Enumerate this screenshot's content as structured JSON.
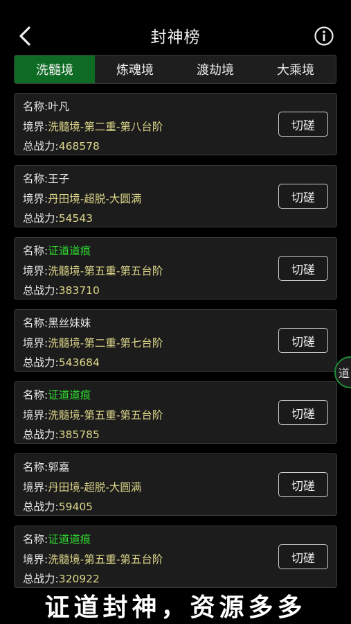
{
  "header": {
    "title": "封神榜",
    "back_icon": "chevron-left-icon",
    "info_icon": "info-icon"
  },
  "tabs": [
    {
      "label": "洗髓境",
      "active": true
    },
    {
      "label": "炼魂境",
      "active": false
    },
    {
      "label": "渡劫境",
      "active": false
    },
    {
      "label": "大乘境",
      "active": false
    }
  ],
  "colors": {
    "accent_green": "#0e6b23",
    "value_yellow": "#dcd68a",
    "name_green": "#2fd62f"
  },
  "labels": {
    "name": "名称:",
    "realm": "境界:",
    "power": "总战力:",
    "spar_button": "切磋"
  },
  "players": [
    {
      "name": "叶凡",
      "name_color": "white",
      "realm": "洗髓境-第二重-第八台阶",
      "power": "468578"
    },
    {
      "name": "王子",
      "name_color": "white",
      "realm": "丹田境-超脱-大圆满",
      "power": "54543"
    },
    {
      "name": "证道道痕",
      "name_color": "green",
      "realm": "洗髓境-第五重-第五台阶",
      "power": "383710"
    },
    {
      "name": "黑丝妹妹",
      "name_color": "white",
      "realm": "洗髓境-第二重-第七台阶",
      "power": "543684"
    },
    {
      "name": "证道道痕",
      "name_color": "green",
      "realm": "洗髓境-第五重-第五台阶",
      "power": "385785"
    },
    {
      "name": "郭嘉",
      "name_color": "white",
      "realm": "丹田境-超脱-大圆满",
      "power": "59405"
    },
    {
      "name": "证道道痕",
      "name_color": "green",
      "realm": "洗髓境-第五重-第五台阶",
      "power": "320922"
    }
  ],
  "side_button": {
    "label": "道"
  },
  "slogan": "证道封神，资源多多"
}
